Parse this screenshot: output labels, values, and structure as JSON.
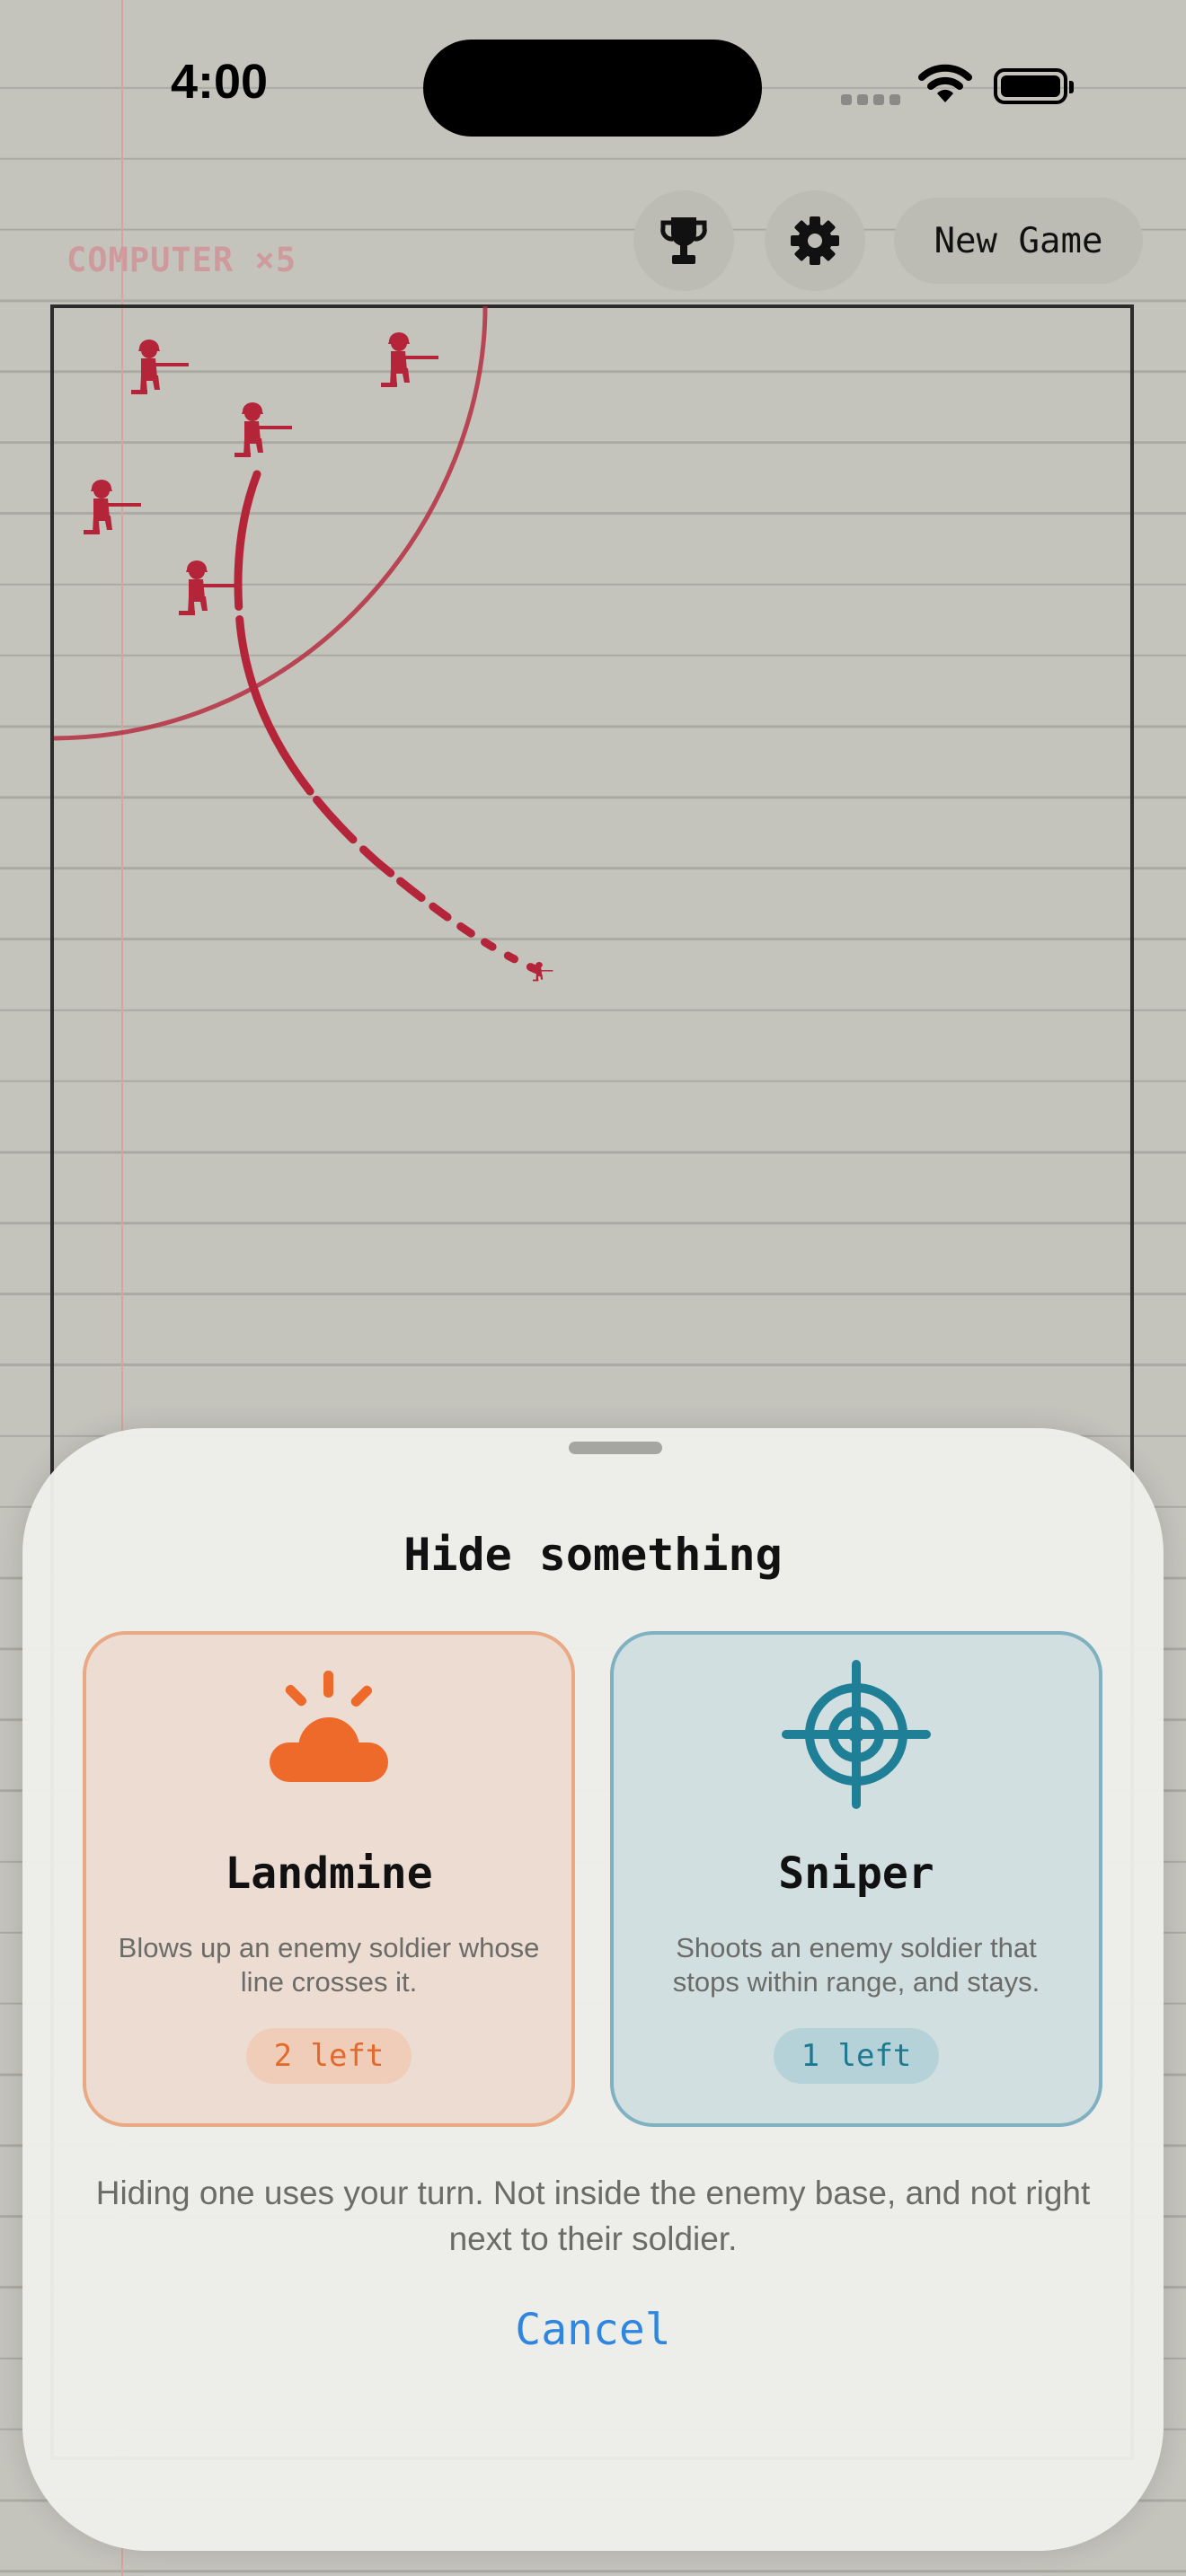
{
  "status_bar": {
    "time": "4:00"
  },
  "toolbar": {
    "trophy_icon": "trophy-icon",
    "settings_icon": "gear-icon",
    "new_game_label": "New Game"
  },
  "board": {
    "opponent_label": "COMPUTER ×5",
    "soldier_color": "#b5253a"
  },
  "sheet": {
    "title": "Hide something",
    "options": [
      {
        "title": "Landmine",
        "icon": "landmine-icon",
        "description": "Blows up an enemy soldier whose line crosses it.",
        "remaining": "2 left",
        "accent": "#ee6a2b"
      },
      {
        "title": "Sniper",
        "icon": "crosshair-icon",
        "description": "Shoots an enemy soldier that stops within range, and stays.",
        "remaining": "1 left",
        "accent": "#1e7f96"
      }
    ],
    "hint": "Hiding one uses your turn. Not inside the enemy base, and not right next to their soldier.",
    "cancel_label": "Cancel"
  }
}
